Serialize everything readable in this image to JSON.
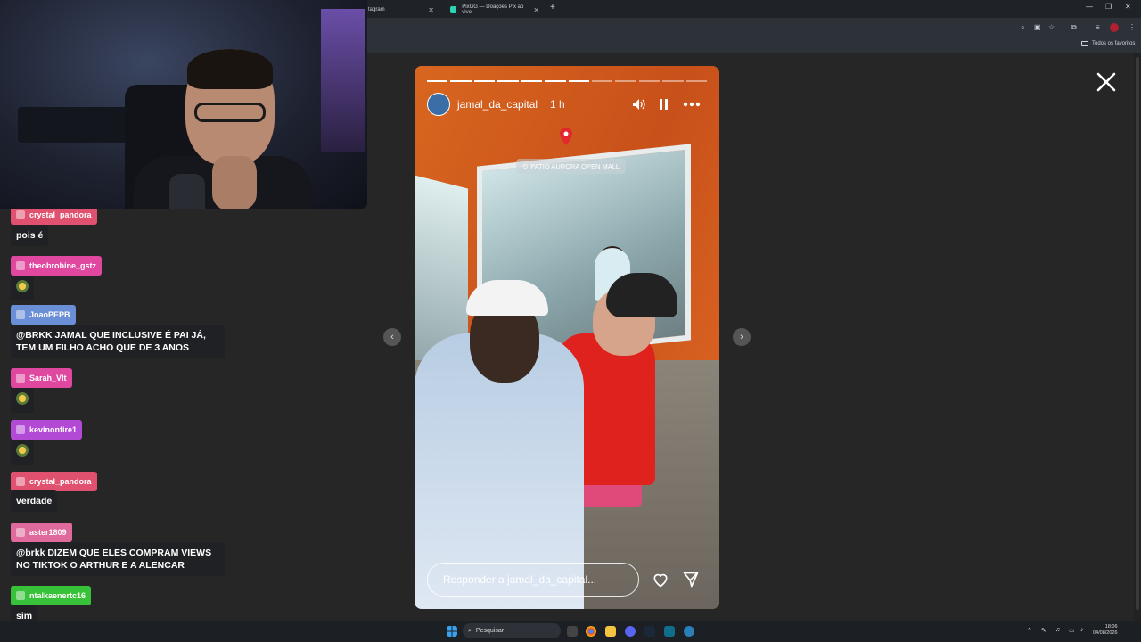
{
  "browser": {
    "tabs": [
      {
        "label": "tagram",
        "close": "✕"
      },
      {
        "label": "PixGG — Doações Pix ao vivo",
        "close": "✕"
      }
    ],
    "new_tab": "+",
    "bookmarks_folder": "Todos os favoritos"
  },
  "chat": {
    "messages": [
      {
        "user": "crystal_pandora",
        "text": "pois é",
        "color": "#e0516f"
      },
      {
        "user": "theobrobine_gstz",
        "text": "",
        "color": "#e0479e",
        "emoji": true
      },
      {
        "user": "JoaoPEPB",
        "text": "@BRKK JAMAL QUE INCLUSIVE É PAI JÁ, TEM UM FILHO ACHO QUE DE 3 ANOS",
        "color": "#6b8fd6"
      },
      {
        "user": "Sarah_Vlt",
        "text": "",
        "color": "#e0479e",
        "emoji": true
      },
      {
        "user": "kevinonfire1",
        "text": "",
        "color": "#b34ad6",
        "emoji": true
      },
      {
        "user": "crystal_pandora",
        "text": "verdade",
        "color": "#e0516f"
      },
      {
        "user": "aster1809",
        "text": "@brkk DIZEM QUE ELES COMPRAM VIEWS NO TIKTOK O ARTHUR E A ALENCAR",
        "color": "#e06a9b"
      },
      {
        "user": "ntalkaenertc16",
        "text": "sim",
        "color": "#38c23a"
      }
    ]
  },
  "story": {
    "username": "jamal_da_capital",
    "time": "1 h",
    "location": "PATIO AURORA OPEN MALL",
    "reply_placeholder": "Responder a jamal_da_capital...",
    "progress_total": 12,
    "progress_done": 7,
    "icons": {
      "sound": "speaker-icon",
      "pause": "pause-icon",
      "more": "more-icon",
      "heart": "heart-icon",
      "send": "send-icon"
    }
  },
  "nav": {
    "prev": "‹",
    "next": "›"
  },
  "taskbar": {
    "search_label": "Pesquisar",
    "time": "18:06",
    "date": "04/08/2026"
  }
}
